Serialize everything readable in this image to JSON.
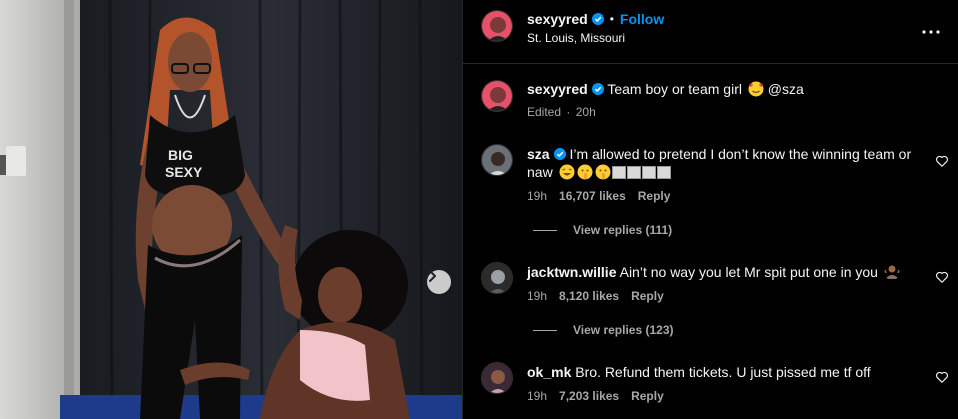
{
  "post": {
    "next_label": "›"
  },
  "header": {
    "username": "sexyyred",
    "follow_label": "Follow",
    "separator": "•",
    "location": "St. Louis, Missouri"
  },
  "caption": {
    "username": "sexyyred",
    "text": "Team boy or team girl",
    "mention": "@sza",
    "edited": "Edited",
    "separator": "·",
    "time": "20h"
  },
  "comments": [
    {
      "username": "sza",
      "verified": true,
      "text": "I’m allowed to pretend I don’t know the winning team or naw",
      "time": "19h",
      "likes": "16,707 likes",
      "reply_label": "Reply",
      "view_replies": "View replies (111)"
    },
    {
      "username": "jacktwn.willie",
      "verified": false,
      "text": "Ain’t no way you let Mr spit put one in you",
      "time": "19h",
      "likes": "8,120 likes",
      "reply_label": "Reply",
      "view_replies": "View replies (123)"
    },
    {
      "username": "ok_mk",
      "verified": false,
      "text": "Bro. Refund them tickets. U just pissed me tf off",
      "time": "19h",
      "likes": "7,203 likes",
      "reply_label": "Reply"
    }
  ],
  "colors": {
    "accent": "#0095f6",
    "background": "#000000",
    "secondary_text": "#a8a8a8"
  },
  "icons": {
    "verified": "verified-badge-icon",
    "more": "more-options-icon",
    "heart": "heart-outline-icon",
    "next": "chevron-right-icon"
  }
}
